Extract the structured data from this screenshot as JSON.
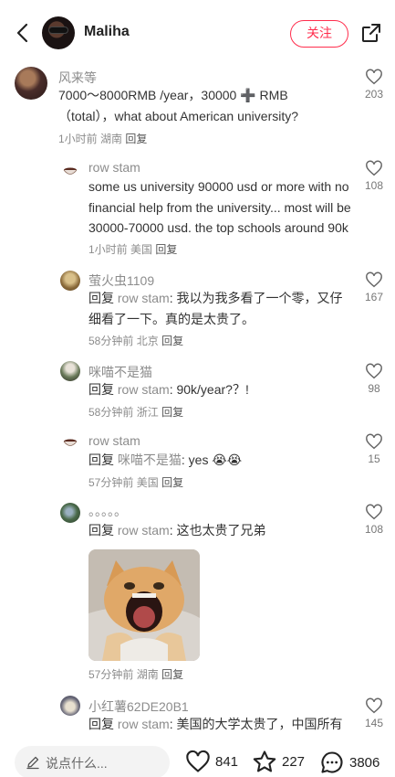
{
  "header": {
    "author_name": "Maliha",
    "follow_label": "关注"
  },
  "comments": [
    {
      "user": "风来等",
      "text": "7000～8000RMB /year，30000 ➕ RMB（total），what about American university?",
      "time": "1小时前",
      "location": "湖南",
      "reply_label": "回复",
      "likes": "203"
    },
    {
      "user": "row stam",
      "text": "some us university 90000 usd or more with no financial help from the university... most will be 30000-70000 usd. the top schools around 90k",
      "time": "1小时前",
      "location": "美国",
      "reply_label": "回复",
      "likes": "108"
    },
    {
      "user": "萤火虫1109",
      "reply_prefix": "回复",
      "reply_to": "row stam",
      "text": "我以为我多看了一个零，又仔细看了一下。真的是太贵了。",
      "time": "58分钟前",
      "location": "北京",
      "reply_label": "回复",
      "likes": "167"
    },
    {
      "user": "咪喵不是猫",
      "reply_prefix": "回复",
      "reply_to": "row stam",
      "text": "90k/year?？!",
      "time": "58分钟前",
      "location": "浙江",
      "reply_label": "回复",
      "likes": "98"
    },
    {
      "user": "row stam",
      "reply_prefix": "回复",
      "reply_to": "咪喵不是猫",
      "text": "yes",
      "emoji": "😭😭",
      "time": "57分钟前",
      "location": "美国",
      "reply_label": "回复",
      "likes": "15"
    },
    {
      "user": "。。。。。",
      "reply_prefix": "回复",
      "reply_to": "row stam",
      "text": "这也太贵了兄弟",
      "time": "57分钟前",
      "location": "湖南",
      "reply_label": "回复",
      "likes": "108"
    },
    {
      "user": "小红薯62DE20B1",
      "reply_prefix": "回复",
      "reply_to": "row stam",
      "text": "美国的大学太贵了，中国所有",
      "likes": "145"
    }
  ],
  "bottom_bar": {
    "input_placeholder": "说点什么...",
    "likes": "841",
    "stars": "227",
    "comments": "3806"
  },
  "colors": {
    "accent": "#ff2e4d",
    "muted_text": "#8c8c8c",
    "body_text": "#333333"
  },
  "icons": [
    "back-arrow-icon",
    "share-icon",
    "heart-icon",
    "star-icon",
    "comment-bubble-icon",
    "pencil-icon"
  ]
}
